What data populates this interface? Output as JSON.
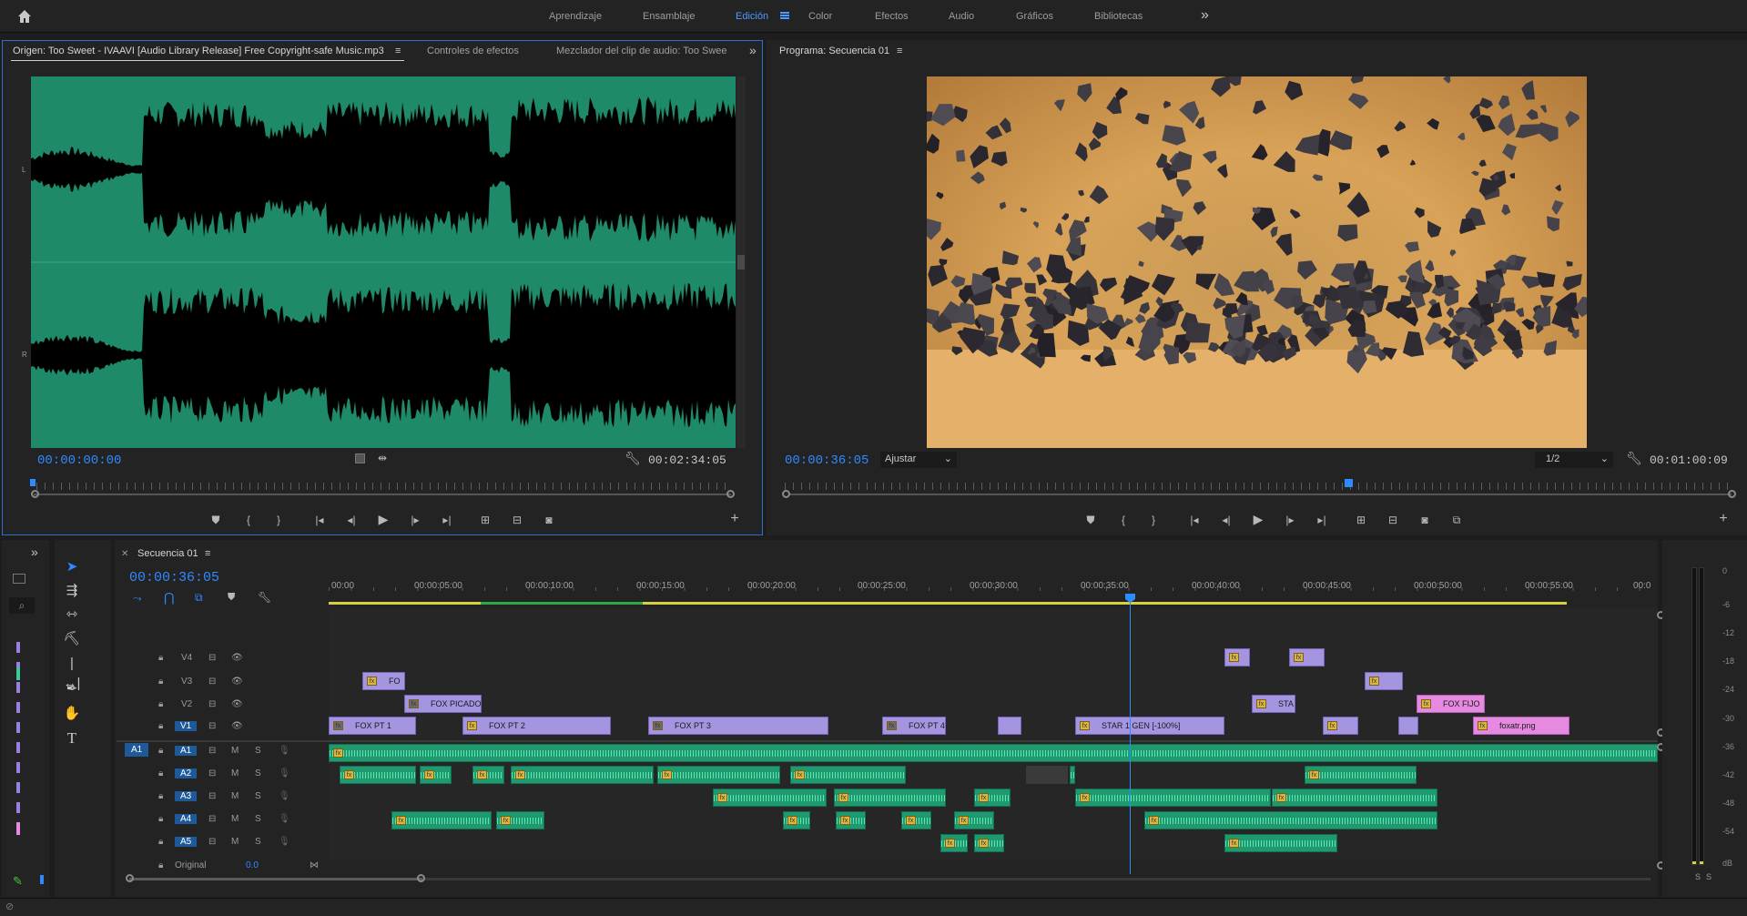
{
  "workspaces": {
    "items": [
      "Aprendizaje",
      "Ensamblaje",
      "Edición",
      "Color",
      "Efectos",
      "Audio",
      "Gráficos",
      "Bibliotecas"
    ],
    "active": "Edición",
    "more": "»"
  },
  "source_panel": {
    "tab_origin": "Origen: Too Sweet - IVAAVI [Audio Library Release]  Free Copyright-safe Music.mp3",
    "tab_effects": "Controles de efectos",
    "tab_mixer": "Mezclador del clip de audio: Too Swee",
    "timecode_in": "00:00:00:00",
    "duration": "00:02:34:05",
    "channel_L": "L",
    "channel_R": "R"
  },
  "program_panel": {
    "tab": "Programa: Secuencia 01",
    "timecode": "00:00:36:05",
    "fit": "Ajustar",
    "resolution": "1/2",
    "duration": "00:01:00:09"
  },
  "timeline": {
    "tab": "Secuencia 01",
    "timecode": "00:00:36:05",
    "ruler": [
      "00:00",
      "00:00:05:00",
      "00:00:10:00",
      "00:00:15:00",
      "00:00:20:00",
      "00:00:25:00",
      "00:00:30:00",
      "00:00:35:00",
      "00:00:40:00",
      "00:00:45:00",
      "00:00:50:00",
      "00:00:55:00",
      "00:0"
    ],
    "video_tracks": [
      "V4",
      "V3",
      "V2",
      "V1"
    ],
    "audio_tracks": [
      "A1",
      "A2",
      "A3",
      "A4",
      "A5"
    ],
    "source_patch": "A1",
    "mute": "M",
    "solo": "S",
    "master_label": "Original",
    "master_value": "0.0",
    "fx": "fx",
    "clips": {
      "v3_fo": "FO",
      "v2_picado": "FOX PICADO",
      "v2_sta": "STA",
      "v2_fijo": "FOX FIJO",
      "v1_pt1": "FOX PT 1",
      "v1_pt2": "FOX PT 2",
      "v1_pt3": "FOX PT 3",
      "v1_pt4": "FOX PT 4",
      "v1_star": "STAR 1 GEN [-100%]",
      "v1_png": "foxatr.png"
    }
  },
  "meter": {
    "scale": [
      "0",
      "-6",
      "-12",
      "-18",
      "-24",
      "-30",
      "-36",
      "-42",
      "-48",
      "-54",
      "dB"
    ],
    "solo_left": "S",
    "solo_right": "S"
  },
  "colors": {
    "accent_blue": "#2f8aff",
    "waveform_bg": "#1e8a6a",
    "video_clip": "#a594e0",
    "audio_clip": "#1f9a70",
    "pink_clip": "#e58ae0"
  }
}
